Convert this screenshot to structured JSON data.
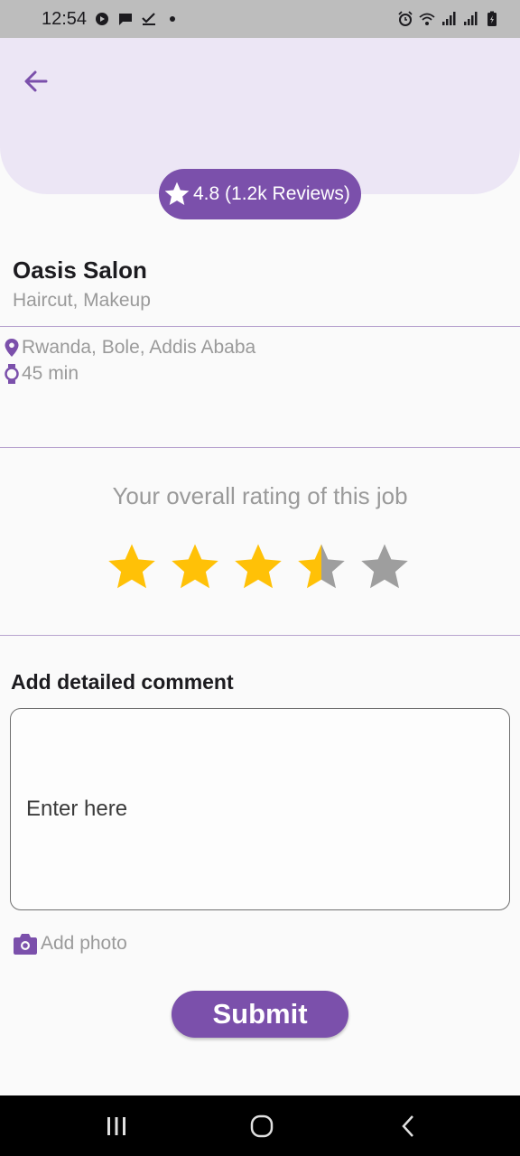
{
  "status_bar": {
    "time": "12:54",
    "left_icons": [
      "app-notification-icon",
      "message-icon",
      "check-icon",
      "dot-icon"
    ],
    "right_icons": [
      "alarm-icon",
      "wifi-icon",
      "signal-icon",
      "signal-icon",
      "battery-charging-icon"
    ]
  },
  "header": {
    "back_icon": "arrow-left-icon",
    "rating_text": "4.8 (1.2k Reviews)"
  },
  "shop": {
    "name": "Oasis Salon",
    "services": "Haircut, Makeup",
    "location": "Rwanda, Bole, Addis Ababa",
    "duration": "45 min"
  },
  "rating": {
    "title": "Your overall rating of this job",
    "value": 3.5,
    "max": 5
  },
  "comment": {
    "title": "Add detailed comment",
    "placeholder": "Enter here"
  },
  "add_photo_label": "Add photo",
  "submit_label": "Submit",
  "colors": {
    "accent": "#7b50ab",
    "header_bg": "#ece6f5",
    "star_filled": "#ffc107",
    "star_empty": "#9e9e9e",
    "muted_text": "#9a9a9a"
  }
}
